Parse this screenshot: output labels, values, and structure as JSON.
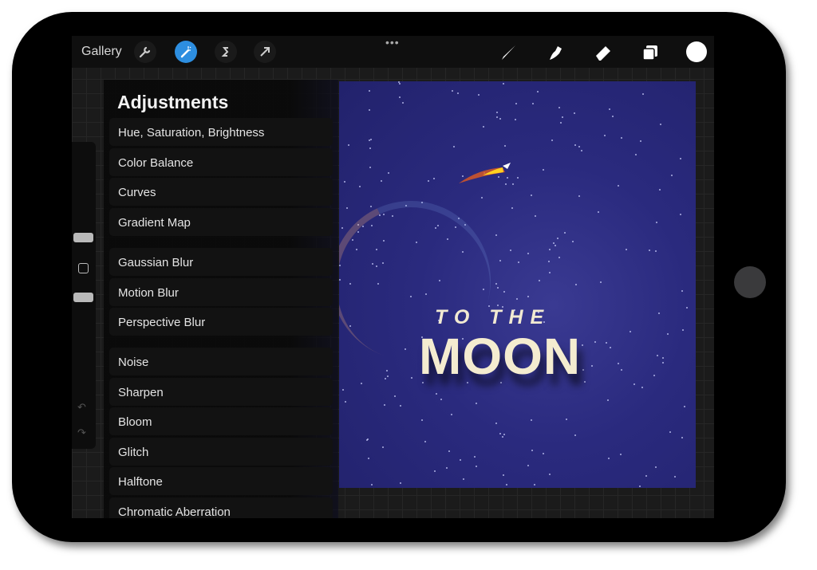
{
  "toolbar": {
    "gallery_label": "Gallery",
    "accent": "#2d8ee0",
    "tools_left": [
      "wrench-icon",
      "magic-wand-icon",
      "selection-icon",
      "transform-arrow-icon"
    ],
    "tools_right": [
      "brush-icon",
      "smudge-icon",
      "eraser-icon",
      "layers-icon",
      "color-swatch"
    ],
    "more": "•••",
    "current_color": "#ffffff"
  },
  "panel": {
    "title": "Adjustments",
    "groups": [
      [
        "Hue, Saturation, Brightness",
        "Color Balance",
        "Curves",
        "Gradient Map"
      ],
      [
        "Gaussian Blur",
        "Motion Blur",
        "Perspective Blur"
      ],
      [
        "Noise",
        "Sharpen",
        "Bloom",
        "Glitch",
        "Halftone",
        "Chromatic Aberration"
      ]
    ]
  },
  "artwork": {
    "line1": "TO THE",
    "line2": "MOON",
    "background": "#2a2a7e"
  },
  "sidebar": {
    "undo": "↶",
    "redo": "↷"
  }
}
